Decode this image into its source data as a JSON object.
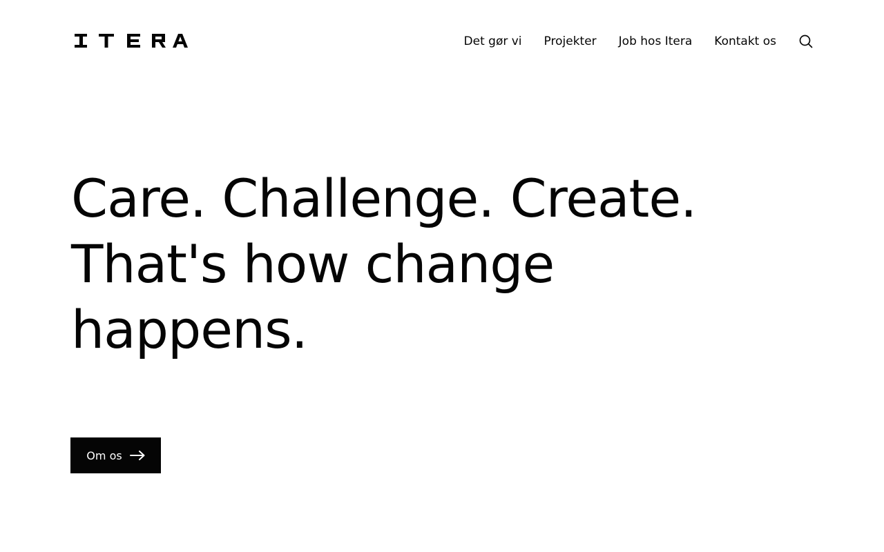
{
  "brand": {
    "name": "ITERA",
    "letters": [
      "I",
      "T",
      "E",
      "R",
      "A"
    ]
  },
  "nav": {
    "items": [
      {
        "label": "Det gør vi"
      },
      {
        "label": "Projekter"
      },
      {
        "label": "Job hos Itera"
      },
      {
        "label": "Kontakt os"
      }
    ],
    "search_icon": "search-icon"
  },
  "hero": {
    "lines": [
      "Care. Challenge. Create.",
      "That's how change",
      "happens."
    ]
  },
  "cta": {
    "label": "Om os",
    "icon": "arrow-right-icon"
  },
  "colors": {
    "text": "#050505",
    "background": "#ffffff",
    "button_bg": "#050505",
    "button_text": "#ffffff"
  }
}
